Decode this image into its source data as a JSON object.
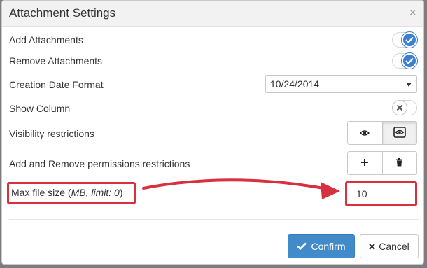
{
  "dialog": {
    "title": "Attachment Settings",
    "close_glyph": "×"
  },
  "rows": {
    "add_attachments": {
      "label": "Add Attachments",
      "enabled": true
    },
    "remove_attachments": {
      "label": "Remove Attachments",
      "enabled": true
    },
    "creation_date_format": {
      "label": "Creation Date Format",
      "value": "10/24/2014"
    },
    "show_column": {
      "label": "Show Column",
      "enabled": false
    },
    "visibility_restrictions": {
      "label": "Visibility restrictions",
      "icons": [
        "eye-icon",
        "eye-framed-icon"
      ]
    },
    "permissions_restrictions": {
      "label": "Add and Remove permissions restrictions",
      "icons": [
        "plus-icon",
        "trash-icon"
      ]
    },
    "max_file_size": {
      "label_main": "Max file size (",
      "label_hint": "MB, limit: 0",
      "label_end": ")",
      "value": "10"
    }
  },
  "footer": {
    "confirm_label": "Confirm",
    "cancel_label": "Cancel"
  },
  "colors": {
    "accent": "#428bca",
    "toggle_on": "#3a7fd1",
    "annotation": "#d8303f"
  }
}
